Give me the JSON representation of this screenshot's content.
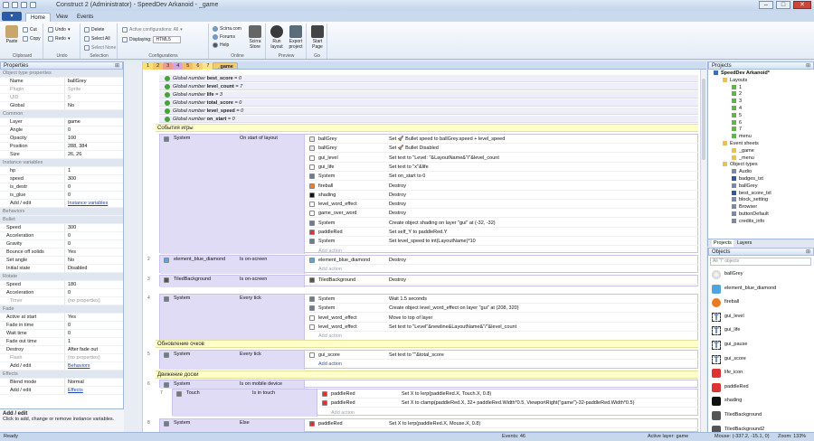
{
  "app": {
    "title": "Construct 2 (Administrator) - SpeedDev Arkanoid - _game"
  },
  "ribbon": {
    "file_label": "",
    "tabs": [
      "Home",
      "View",
      "Events"
    ],
    "clipboard": {
      "paste": "Paste",
      "cut": "Cut",
      "copy": "Copy",
      "label": "Clipboard"
    },
    "undo": {
      "undo": "Undo",
      "redo": "Redo",
      "label": "Undo"
    },
    "selection": {
      "delete": "Delete",
      "select_all": "Select All",
      "select_none": "Select None",
      "label": "Selection"
    },
    "configurations": {
      "active": "Active configurations: All",
      "displaying": "Displaying:",
      "displaying_value": "HTML5",
      "label": "Configurations"
    },
    "online": {
      "scirra": "Scirra.com",
      "forums": "Forums",
      "help": "Help",
      "store": "Scirra Store",
      "label": "Online"
    },
    "preview": {
      "run": "Run layout",
      "export": "Export project",
      "label": "Preview"
    },
    "go": {
      "start": "Start Page",
      "label": "Go"
    }
  },
  "properties": {
    "title": "Properties",
    "rows": [
      {
        "k": "Object type properties",
        "v": "",
        "type": "cat"
      },
      {
        "k": "Name",
        "v": "ballGrey"
      },
      {
        "k": "Plugin",
        "v": "Sprite",
        "type": "gray"
      },
      {
        "k": "UID",
        "v": "5",
        "type": "gray"
      },
      {
        "k": "Global",
        "v": "No"
      },
      {
        "k": "Common",
        "v": "",
        "type": "cat"
      },
      {
        "k": "Layer",
        "v": "game"
      },
      {
        "k": "Angle",
        "v": "0"
      },
      {
        "k": "Opacity",
        "v": "100"
      },
      {
        "k": "Position",
        "v": "288, 384"
      },
      {
        "k": "Size",
        "v": "26, 26"
      },
      {
        "k": "Instance variables",
        "v": "",
        "type": "cat"
      },
      {
        "k": "hp",
        "v": "1"
      },
      {
        "k": "speed",
        "v": "300"
      },
      {
        "k": "is_destr",
        "v": "0"
      },
      {
        "k": "is_glue",
        "v": "0"
      },
      {
        "k": "Add / edit",
        "v": "Instance variables",
        "type": "link"
      },
      {
        "k": "Behaviors",
        "v": "",
        "type": "cat"
      },
      {
        "k": "Bullet",
        "v": "",
        "type": "cat"
      },
      {
        "k": "Speed",
        "v": "300",
        "type": "sub"
      },
      {
        "k": "Acceleration",
        "v": "0",
        "type": "sub"
      },
      {
        "k": "Gravity",
        "v": "0",
        "type": "sub"
      },
      {
        "k": "Bounce off solids",
        "v": "Yes",
        "type": "sub"
      },
      {
        "k": "Set angle",
        "v": "No",
        "type": "sub"
      },
      {
        "k": "Initial state",
        "v": "Disabled",
        "type": "sub"
      },
      {
        "k": "Rotate",
        "v": "",
        "type": "cat"
      },
      {
        "k": "Speed",
        "v": "180",
        "type": "sub"
      },
      {
        "k": "Acceleration",
        "v": "0",
        "type": "sub"
      },
      {
        "k": "Timer",
        "v": "(no properties)",
        "type": "gray"
      },
      {
        "k": "Fade",
        "v": "",
        "type": "cat"
      },
      {
        "k": "Active at start",
        "v": "Yes",
        "type": "sub"
      },
      {
        "k": "Fade in time",
        "v": "0",
        "type": "sub"
      },
      {
        "k": "Wait time",
        "v": "0",
        "type": "sub"
      },
      {
        "k": "Fade out time",
        "v": "1",
        "type": "sub"
      },
      {
        "k": "Destroy",
        "v": "After fade out",
        "type": "sub"
      },
      {
        "k": "Flash",
        "v": "(no properties)",
        "type": "gray"
      },
      {
        "k": "Add / edit",
        "v": "Behaviors",
        "type": "link"
      },
      {
        "k": "Effects",
        "v": "",
        "type": "cat"
      },
      {
        "k": "Blend mode",
        "v": "Normal"
      },
      {
        "k": "Add / edit",
        "v": "Effects",
        "type": "link"
      }
    ],
    "help_title": "Add / edit",
    "help_text": "Click to add, change or remove instance variables."
  },
  "editor_tabs": [
    "1",
    "2",
    "3",
    "4",
    "5",
    "6",
    "7",
    "_game"
  ],
  "event_sheet": {
    "globals": [
      {
        "pre": "Global number ",
        "name": "best_score",
        "val": " = 0"
      },
      {
        "pre": "Global number ",
        "name": "level_count",
        "val": " = 7"
      },
      {
        "pre": "Global number ",
        "name": "life",
        "val": " = 3"
      },
      {
        "pre": "Global number ",
        "name": "total_score",
        "val": " = 0"
      },
      {
        "pre": "Global number ",
        "name": "level_speed",
        "val": " = 0"
      },
      {
        "pre": "Global number ",
        "name": "on_start",
        "val": " = 0"
      }
    ],
    "comments": [
      "События игры",
      "Обновление очков",
      "Движение доски"
    ],
    "ev1": {
      "num": "",
      "cond_obj": "System",
      "cond": "On start of layout",
      "actions": [
        {
          "o": "ballGrey",
          "d": "Set 🚀 Bullet speed to ballGrey.speed + level_speed"
        },
        {
          "o": "ballGrey",
          "d": "Set 🚀 Bullet Disabled"
        },
        {
          "o": "gui_level",
          "d": "Set text to \"Level: \"&LayoutName&\"/\"&level_count"
        },
        {
          "o": "gui_life",
          "d": "Set text to \"x\"&life"
        },
        {
          "o": "System",
          "d": "Set on_start to 0"
        },
        {
          "o": "fireball",
          "d": "Destroy"
        },
        {
          "o": "shading",
          "d": "Destroy"
        },
        {
          "o": "level_word_effect",
          "d": "Destroy"
        },
        {
          "o": "game_over_word",
          "d": "Destroy"
        },
        {
          "o": "System",
          "d": "Create object shading on layer \"gui\" at (-32, -32)"
        },
        {
          "o": "paddleRed",
          "d": "Set self_Y to paddleRed.Y"
        },
        {
          "o": "System",
          "d": "Set level_speed to int(LayoutName)*10"
        }
      ],
      "add": "Add action"
    },
    "ev2": {
      "num": "2",
      "cond_obj": "element_blue_diamond",
      "cond": "Is on-screen",
      "act_o": "element_blue_diamond",
      "act_d": "Destroy",
      "add": "Add action"
    },
    "ev3": {
      "num": "3",
      "cond_obj": "TiledBackground",
      "cond": "Is on-screen",
      "act_o": "TiledBackground",
      "act_d": "Destroy"
    },
    "ev4": {
      "num": "4",
      "cond_obj": "System",
      "cond": "Every tick",
      "actions": [
        {
          "o": "System",
          "d": "Wait 1.5 seconds"
        },
        {
          "o": "System",
          "d": "Create object level_word_effect on layer \"gui\" at (208, 320)"
        },
        {
          "o": "level_word_effect",
          "d": "Move to top of layer"
        },
        {
          "o": "level_word_effect",
          "d": "Set text to \"Level\"&newline&LayoutName&\"/\"&level_count"
        }
      ],
      "add": "Add action"
    },
    "ev5": {
      "num": "5",
      "cond_obj": "System",
      "cond": "Every tick",
      "act_o": "gui_score",
      "act_d": "Set text to \"\"&total_score",
      "add": "Add action"
    },
    "ev6": {
      "num": "6",
      "cond_obj": "System",
      "cond": "Is on mobile device"
    },
    "ev7": {
      "num": "7",
      "cond_obj": "Touch",
      "cond": "Is in touch",
      "actions": [
        {
          "o": "paddleRed",
          "d": "Set X to lerp(paddleRed.X, Touch.X, 0.8)"
        },
        {
          "o": "paddleRed",
          "d": "Set X to clamp(paddleRed.X, 32+ paddleRed.Width*0.5, ViewportRight(\"game\")-32-paddleRed.Width*0.5)"
        }
      ],
      "add": "Add action"
    },
    "ev8": {
      "num": "8",
      "cond_obj": "System",
      "cond": "Else",
      "act_o": "paddleRed",
      "act_d": "Set X to lerp(paddleRed.X, Mouse.X, 0.8)"
    }
  },
  "projects": {
    "title": "Projects",
    "tree": [
      {
        "t": "SpeedDev Arkanoid*",
        "lvl": 0,
        "k": "proj"
      },
      {
        "t": "Layouts",
        "lvl": 1,
        "k": "folder"
      },
      {
        "t": "1",
        "lvl": 2,
        "k": "layout"
      },
      {
        "t": "2",
        "lvl": 2,
        "k": "layout"
      },
      {
        "t": "3",
        "lvl": 2,
        "k": "layout"
      },
      {
        "t": "4",
        "lvl": 2,
        "k": "layout"
      },
      {
        "t": "5",
        "lvl": 2,
        "k": "layout"
      },
      {
        "t": "6",
        "lvl": 2,
        "k": "layout"
      },
      {
        "t": "7",
        "lvl": 2,
        "k": "layout"
      },
      {
        "t": "menu",
        "lvl": 2,
        "k": "layout"
      },
      {
        "t": "Event sheets",
        "lvl": 1,
        "k": "folder"
      },
      {
        "t": "_game",
        "lvl": 2,
        "k": "sheet"
      },
      {
        "t": "_menu",
        "lvl": 2,
        "k": "sheet"
      },
      {
        "t": "Object types",
        "lvl": 1,
        "k": "folder"
      },
      {
        "t": "Audio",
        "lvl": 2,
        "k": "obj"
      },
      {
        "t": "badges_txt",
        "lvl": 2,
        "k": "text"
      },
      {
        "t": "ballGrey",
        "lvl": 2,
        "k": "obj"
      },
      {
        "t": "best_score_txt",
        "lvl": 2,
        "k": "text"
      },
      {
        "t": "block_setting",
        "lvl": 2,
        "k": "obj"
      },
      {
        "t": "Browser",
        "lvl": 2,
        "k": "obj"
      },
      {
        "t": "buttonDefault",
        "lvl": 2,
        "k": "obj"
      },
      {
        "t": "credits_info",
        "lvl": 2,
        "k": "obj"
      }
    ],
    "tabs": [
      "Projects",
      "Layers"
    ]
  },
  "objects": {
    "title": "Objects",
    "filter": "All \"/\" objects",
    "items": [
      "ballGrey",
      "element_blue_diamond",
      "fireball",
      "gui_level",
      "gui_life",
      "gui_pause",
      "gui_score",
      "life_icon",
      "paddleRed",
      "shading",
      "TiledBackground",
      "TiledBackground2"
    ]
  },
  "status": {
    "left": "Ready",
    "events": "Events: 46",
    "layer": "Active layer: game",
    "mouse": "Mouse: (-337.2, -15.1, 0)",
    "zoom": "Zoom: 133%"
  }
}
